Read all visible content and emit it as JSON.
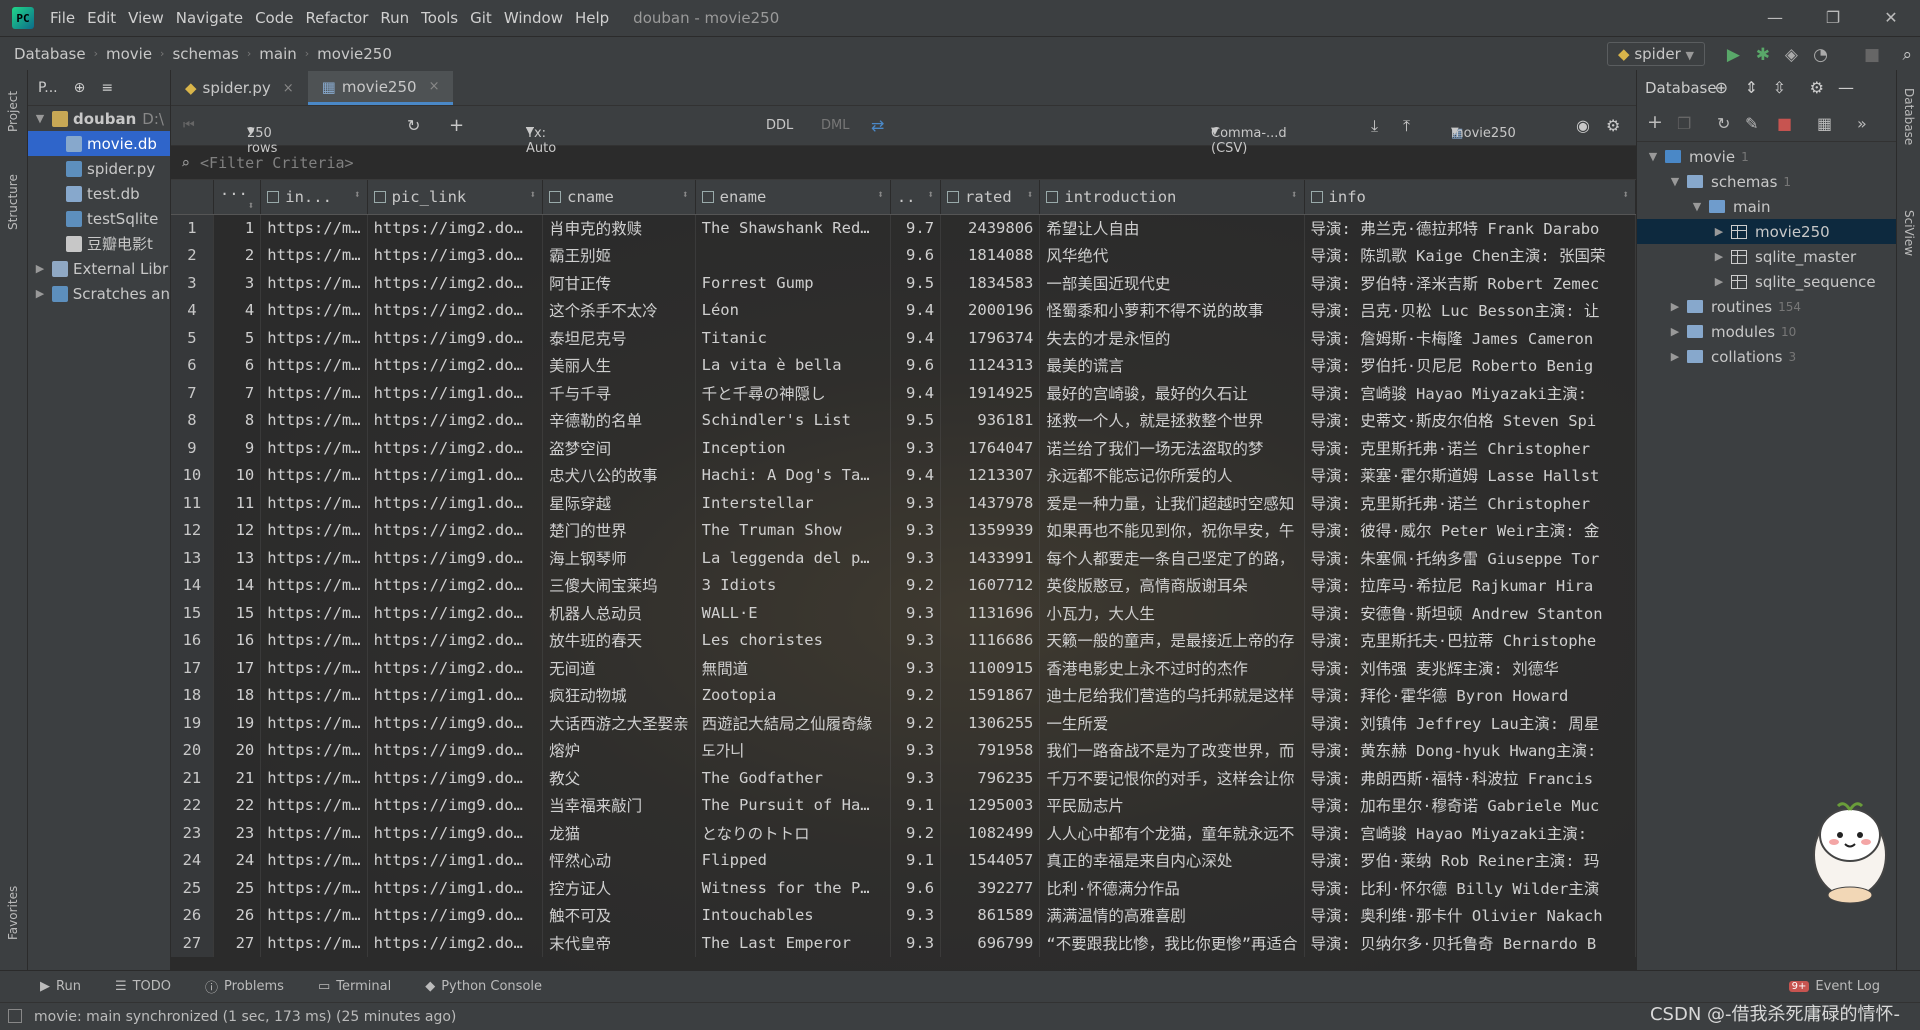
{
  "menubar": {
    "items": [
      "File",
      "Edit",
      "View",
      "Navigate",
      "Code",
      "Refactor",
      "Run",
      "Tools",
      "Git",
      "Window",
      "Help"
    ],
    "title": "douban - movie250"
  },
  "navbar": {
    "crumbs": [
      "Database",
      "movie",
      "schemas",
      "main",
      "movie250"
    ],
    "run_config": "spider"
  },
  "project": {
    "header": "P...",
    "tree": [
      {
        "label": "douban",
        "suffix": "D:\\",
        "kind": "folder"
      },
      {
        "label": "movie.db",
        "kind": "db",
        "selected": true
      },
      {
        "label": "spider.py",
        "kind": "py"
      },
      {
        "label": "test.db",
        "kind": "db"
      },
      {
        "label": "testSqlite",
        "kind": "py"
      },
      {
        "label": "豆瓣电影t",
        "kind": "file"
      },
      {
        "label": "External Libr",
        "kind": "lib"
      },
      {
        "label": "Scratches an",
        "kind": "scratch"
      }
    ]
  },
  "tabs": [
    {
      "label": "spider.py"
    },
    {
      "label": "movie250",
      "active": true
    }
  ],
  "grid_toolbar": {
    "rows": "250 rows",
    "tx": "Tx: Auto",
    "ddl": "DDL",
    "dml": "DML",
    "export": "Comma-...d (CSV)",
    "source": "movie250"
  },
  "filter": {
    "placeholder": "<Filter Criteria>"
  },
  "columns": [
    "...",
    "in...",
    "pic_link",
    "cname",
    "ename",
    "..",
    "rated",
    "introduction",
    "info"
  ],
  "rows": [
    [
      "1",
      "https://m…",
      "https://img2.do…",
      "肖申克的救赎",
      "The Shawshank Red…",
      "9.7",
      "2439806",
      "希望让人自由",
      "导演: 弗兰克·德拉邦特 Frank Darabo"
    ],
    [
      "2",
      "https://m…",
      "https://img3.do…",
      "霸王别姬",
      "",
      "9.6",
      "1814088",
      "风华绝代",
      "导演: 陈凯歌 Kaige Chen主演: 张国荣"
    ],
    [
      "3",
      "https://m…",
      "https://img2.do…",
      "阿甘正传",
      "Forrest Gump",
      "9.5",
      "1834583",
      "一部美国近现代史",
      "导演: 罗伯特·泽米吉斯 Robert Zemec"
    ],
    [
      "4",
      "https://m…",
      "https://img2.do…",
      "这个杀手不太冷",
      "Léon",
      "9.4",
      "2000196",
      "怪蜀黍和小萝莉不得不说的故事",
      "导演: 吕克·贝松 Luc Besson主演: 让"
    ],
    [
      "5",
      "https://m…",
      "https://img9.do…",
      "泰坦尼克号",
      "Titanic",
      "9.4",
      "1796374",
      "失去的才是永恒的",
      "导演: 詹姆斯·卡梅隆 James Cameron"
    ],
    [
      "6",
      "https://m…",
      "https://img2.do…",
      "美丽人生",
      "La vita è bella",
      "9.6",
      "1124313",
      "最美的谎言",
      "导演: 罗伯托·贝尼尼 Roberto Benig"
    ],
    [
      "7",
      "https://m…",
      "https://img1.do…",
      "千与千寻",
      "千と千尋の神隠し",
      "9.4",
      "1914925",
      "最好的宫崎骏，最好的久石让",
      "导演: 宫崎骏 Hayao Miyazaki主演: "
    ],
    [
      "8",
      "https://m…",
      "https://img2.do…",
      "辛德勒的名单",
      "Schindler's List",
      "9.5",
      "936181",
      "拯救一个人，就是拯救整个世界",
      "导演: 史蒂文·斯皮尔伯格 Steven Spi"
    ],
    [
      "9",
      "https://m…",
      "https://img2.do…",
      "盗梦空间",
      "Inception",
      "9.3",
      "1764047",
      "诺兰给了我们一场无法盗取的梦",
      "导演: 克里斯托弗·诺兰 Christopher "
    ],
    [
      "10",
      "https://m…",
      "https://img1.do…",
      "忠犬八公的故事",
      "Hachi: A Dog's Ta…",
      "9.4",
      "1213307",
      "永远都不能忘记你所爱的人",
      "导演: 莱塞·霍尔斯道姆 Lasse Hallst"
    ],
    [
      "11",
      "https://m…",
      "https://img1.do…",
      "星际穿越",
      "Interstellar",
      "9.3",
      "1437978",
      "爱是一种力量，让我们超越时空感知",
      "导演: 克里斯托弗·诺兰 Christopher "
    ],
    [
      "12",
      "https://m…",
      "https://img2.do…",
      "楚门的世界",
      "The Truman Show",
      "9.3",
      "1359939",
      "如果再也不能见到你，祝你早安，午",
      "导演: 彼得·威尔 Peter Weir主演: 金"
    ],
    [
      "13",
      "https://m…",
      "https://img9.do…",
      "海上钢琴师",
      "La leggenda del p…",
      "9.3",
      "1433991",
      "每个人都要走一条自己坚定了的路，",
      "导演: 朱塞佩·托纳多雷 Giuseppe Tor"
    ],
    [
      "14",
      "https://m…",
      "https://img2.do…",
      "三傻大闹宝莱坞",
      "3 Idiots",
      "9.2",
      "1607712",
      "英俊版憨豆，高情商版谢耳朵",
      "导演: 拉库马·希拉尼 Rajkumar Hira"
    ],
    [
      "15",
      "https://m…",
      "https://img2.do…",
      "机器人总动员",
      "WALL·E",
      "9.3",
      "1131696",
      "小瓦力，大人生",
      "导演: 安德鲁·斯坦顿 Andrew Stanton"
    ],
    [
      "16",
      "https://m…",
      "https://img2.do…",
      "放牛班的春天",
      "Les choristes",
      "9.3",
      "1116686",
      "天籁一般的童声，是最接近上帝的存",
      "导演: 克里斯托夫·巴拉蒂 Christophe"
    ],
    [
      "17",
      "https://m…",
      "https://img2.do…",
      "无间道",
      "無間道",
      "9.3",
      "1100915",
      "香港电影史上永不过时的杰作",
      "导演: 刘伟强   麦兆辉主演: 刘德华"
    ],
    [
      "18",
      "https://m…",
      "https://img1.do…",
      "疯狂动物城",
      "Zootopia",
      "9.2",
      "1591867",
      "迪士尼给我们营造的乌托邦就是这样",
      "导演: 拜伦·霍华德 Byron Howard"
    ],
    [
      "19",
      "https://m…",
      "https://img9.do…",
      "大话西游之大圣娶亲",
      "西遊記大結局之仙履奇緣",
      "9.2",
      "1306255",
      "一生所爱",
      "导演: 刘镇伟 Jeffrey Lau主演: 周星"
    ],
    [
      "20",
      "https://m…",
      "https://img9.do…",
      "熔炉",
      "도가니",
      "9.3",
      "791958",
      "我们一路奋战不是为了改变世界，而",
      "导演: 黄东赫 Dong-hyuk Hwang主演: "
    ],
    [
      "21",
      "https://m…",
      "https://img9.do…",
      "教父",
      "The Godfather",
      "9.3",
      "796235",
      "千万不要记恨你的对手，这样会让你",
      "导演: 弗朗西斯·福特·科波拉 Francis"
    ],
    [
      "22",
      "https://m…",
      "https://img9.do…",
      "当幸福来敲门",
      "The Pursuit of Ha…",
      "9.1",
      "1295003",
      "平民励志片",
      "导演: 加布里尔·穆奇诺 Gabriele Muc"
    ],
    [
      "23",
      "https://m…",
      "https://img9.do…",
      "龙猫",
      "となりのトトロ",
      "9.2",
      "1082499",
      "人人心中都有个龙猫，童年就永远不",
      "导演: 宫崎骏 Hayao Miyazaki主演: "
    ],
    [
      "24",
      "https://m…",
      "https://img1.do…",
      "怦然心动",
      "Flipped",
      "9.1",
      "1544057",
      "真正的幸福是来自内心深处",
      "导演: 罗伯·莱纳 Rob Reiner主演: 玛"
    ],
    [
      "25",
      "https://m…",
      "https://img1.do…",
      "控方证人",
      "Witness for the P…",
      "9.6",
      "392277",
      "比利·怀德满分作品",
      "导演: 比利·怀尔德 Billy Wilder主演"
    ],
    [
      "26",
      "https://m…",
      "https://img9.do…",
      "触不可及",
      "Intouchables",
      "9.3",
      "861589",
      "满满温情的高雅喜剧",
      "导演: 奥利维·那卡什 Olivier Nakach"
    ],
    [
      "27",
      "https://m…",
      "https://img2.do…",
      "末代皇帝",
      "The Last Emperor",
      "9.3",
      "696799",
      "“不要跟我比惨，我比你更惨”再适合",
      "导演: 贝纳尔多·贝托鲁奇 Bernardo B"
    ]
  ],
  "dbpanel": {
    "title": "Database",
    "tree": [
      {
        "label": "movie",
        "count": "1",
        "level": 0,
        "kind": "db",
        "open": true
      },
      {
        "label": "schemas",
        "count": "1",
        "level": 1,
        "kind": "folder",
        "open": true
      },
      {
        "label": "main",
        "count": "",
        "level": 2,
        "kind": "schema",
        "open": true
      },
      {
        "label": "movie250",
        "count": "",
        "level": 3,
        "kind": "table",
        "selected": true
      },
      {
        "label": "sqlite_master",
        "count": "",
        "level": 3,
        "kind": "table"
      },
      {
        "label": "sqlite_sequence",
        "count": "",
        "level": 3,
        "kind": "table"
      },
      {
        "label": "routines",
        "count": "154",
        "level": 1,
        "kind": "folder"
      },
      {
        "label": "modules",
        "count": "10",
        "level": 1,
        "kind": "folder"
      },
      {
        "label": "collations",
        "count": "3",
        "level": 1,
        "kind": "folder"
      }
    ]
  },
  "left_strip": {
    "project": "Project",
    "structure": "Structure",
    "favorites": "Favorites"
  },
  "right_strip": {
    "database": "Database",
    "sciview": "SciView"
  },
  "bottom_tools": {
    "run": "Run",
    "todo": "TODO",
    "problems": "Problems",
    "terminal": "Terminal",
    "python_console": "Python Console",
    "event_log": "Event Log",
    "event_badge": "9+"
  },
  "status": {
    "text": "movie: main synchronized (1 sec, 173 ms) (25 minutes ago)",
    "watermark": "CSDN @-借我杀死庸碌的情怀-"
  },
  "colors": {
    "accent": "#2f65ca",
    "run_green": "#59a869",
    "stop_red": "#c75450"
  }
}
